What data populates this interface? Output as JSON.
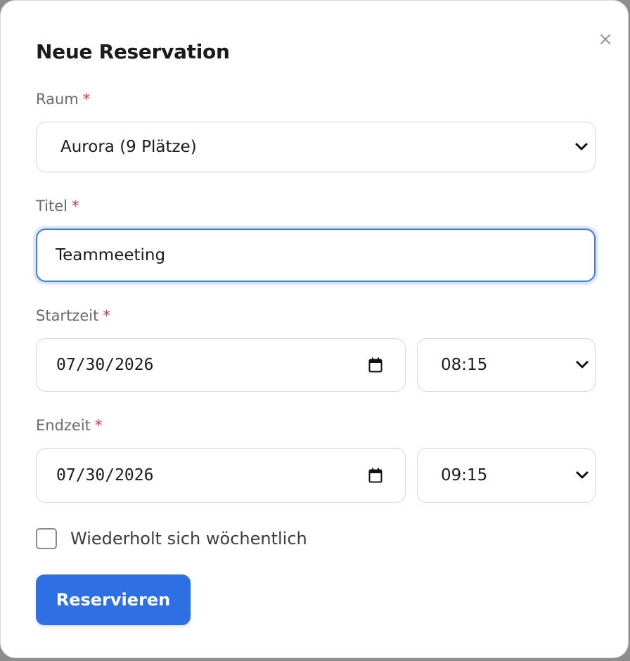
{
  "dialog": {
    "title": "Neue Reservation",
    "close_glyph": "×",
    "close_icon": "close-icon"
  },
  "form": {
    "required_marker": "*",
    "room": {
      "label": "Raum",
      "selected": "Aurora (9 Plätze)"
    },
    "title_field": {
      "label": "Titel",
      "value": "Teammeeting"
    },
    "start": {
      "label": "Startzeit",
      "date": "07/30/2026",
      "time": "08:15"
    },
    "end": {
      "label": "Endzeit",
      "date": "07/30/2026",
      "time": "09:15"
    },
    "recurring": {
      "label": "Wiederholt sich wöchentlich",
      "checked": false
    },
    "submit_label": "Reservieren"
  },
  "colors": {
    "accent": "#2f6fe4",
    "required": "#d93636",
    "focus_ring": "#3d7be8"
  }
}
